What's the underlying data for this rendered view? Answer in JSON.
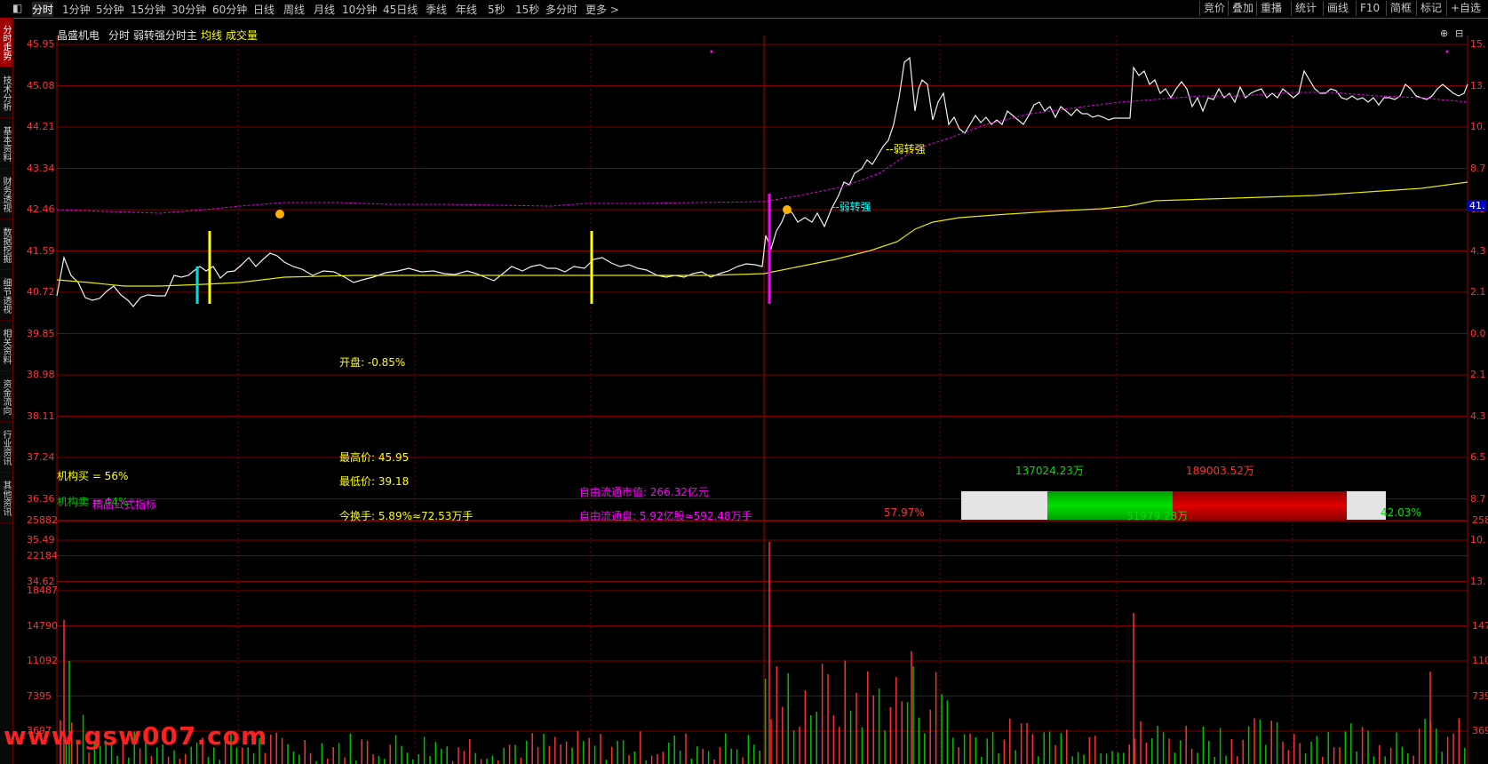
{
  "toolbar": {
    "tabs": [
      "分时",
      "1分钟",
      "5分钟",
      "15分钟",
      "30分钟",
      "60分钟",
      "日线",
      "周线",
      "月线",
      "10分钟",
      "45日线",
      "季线",
      "年线",
      "5秒",
      "15秒",
      "多分时",
      "更多 >"
    ],
    "right_buttons": [
      "竞价",
      "叠加",
      "重播",
      "统计",
      "画线",
      "F10",
      "简框",
      "标记",
      "+自选"
    ]
  },
  "sidebar": {
    "tabs": [
      "分时走势",
      "技术分析",
      "基本资料",
      "财务透视",
      "数据挖掘",
      "细节透视",
      "相关资料",
      "资金流向",
      "行业资讯",
      "其他资讯"
    ]
  },
  "header": {
    "stock_name": "晶盛机电",
    "period": "分时",
    "indicator": "弱转强分时主",
    "avg_label": "均线",
    "volume_label": "成交量"
  },
  "price_axis_left": [
    "45.95",
    "45.08",
    "44.21",
    "43.34",
    "42.46",
    "41.59",
    "40.72",
    "39.85",
    "38.98",
    "38.11",
    "37.24",
    "36.36",
    "35.49",
    "34.62"
  ],
  "price_axis_right": [
    "15.",
    "13.",
    "10.",
    "8.7",
    "6.5",
    "4.3",
    "2.1",
    "0.0",
    "2.1",
    "4.3",
    "6.5",
    "8.7",
    "10.",
    "13."
  ],
  "current_price_tag": "41.",
  "volume_axis_left": [
    "25882",
    "22184",
    "18487",
    "14790",
    "11092",
    "7395",
    "3697"
  ],
  "volume_axis_right": [
    "258",
    "",
    "",
    "147",
    "110",
    "739",
    "369"
  ],
  "signals": {
    "weak_to_strong_1": "--弱转强",
    "weak_to_strong_2": "--弱转强"
  },
  "info": {
    "open": "开盘: -0.85%",
    "high": "最高价: 45.95",
    "low": "最低价: 39.18",
    "turnover": "今换手: 5.89%≈72.53万手",
    "inst_buy": "机构买 = 56%",
    "inst_sell": "机构卖 = 44%",
    "formula": "精品公式指标",
    "float_value": "自由流通市值: 266.32亿元",
    "float_shares": "自由流通盘: 5.92亿股≈592.48万手"
  },
  "flow": {
    "buy_total": "137024.23万",
    "sell_total": "189003.52万",
    "net": "51979.28万",
    "left_pct": "57.97%",
    "right_pct": "42.03%",
    "colors": {
      "buy": "#00c000",
      "sell": "#c00000",
      "neutral": "#e0e0e0"
    }
  },
  "watermark": "www.gsw007.com",
  "footer_partial": "晶盛机电 ..."
}
